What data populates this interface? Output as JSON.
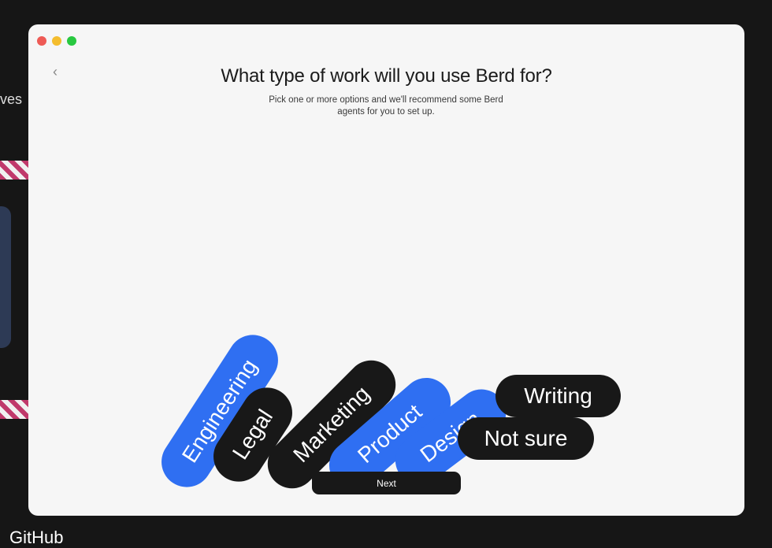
{
  "background": {
    "left_text": "ves",
    "github_label": "GitHub"
  },
  "window": {
    "back_icon": "chevron-left",
    "back_glyph": "‹",
    "title": "What type of work will you use Berd for?",
    "subtitle": "Pick one or more options and we'll recommend some Berd agents for you to set up.",
    "options": [
      {
        "label": "Engineering",
        "color": "#2f6ff2"
      },
      {
        "label": "Legal",
        "color": "#181818"
      },
      {
        "label": "Marketing",
        "color": "#181818"
      },
      {
        "label": "Product",
        "color": "#2f6ff2"
      },
      {
        "label": "Design",
        "color": "#2f6ff2"
      },
      {
        "label": "Writing",
        "color": "#181818"
      },
      {
        "label": "Not sure",
        "color": "#181818"
      }
    ],
    "next_label": "Next"
  },
  "colors": {
    "accent_blue": "#2f6ff2",
    "dark": "#181818",
    "window_bg": "#f6f6f6",
    "traffic_close": "#ee5a55",
    "traffic_min": "#f4bd2e",
    "traffic_max": "#28c840"
  }
}
